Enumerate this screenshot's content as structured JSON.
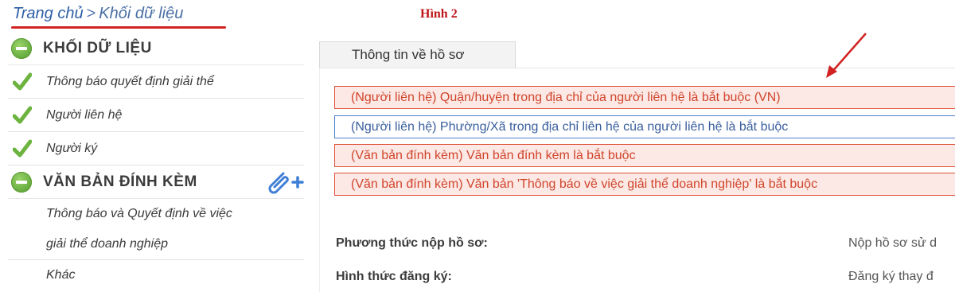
{
  "breadcrumb": {
    "home": "Trang chủ",
    "separator": ">",
    "current": "Khối dữ liệu"
  },
  "figure_caption": "Hình 2",
  "sidebar": {
    "section_data": "KHỐI DỮ LIỆU",
    "data_items": [
      {
        "label": "Thông báo quyết định giải thể",
        "status": "check"
      },
      {
        "label": "Người liên hệ",
        "status": "check"
      },
      {
        "label": "Người ký",
        "status": "check"
      }
    ],
    "section_attach": "VĂN BẢN ĐÍNH KÈM",
    "attach_items": [
      {
        "line1": "Thông báo và Quyết định về việc",
        "line2": "giải thể doanh nghiệp"
      },
      {
        "label": "Khác"
      }
    ]
  },
  "panel": {
    "tab_label": "Thông tin về hồ sơ"
  },
  "messages": [
    {
      "type": "error",
      "text": "(Người liên hệ) Quận/huyện trong địa chỉ của người liên hệ là bắt buộc (VN)"
    },
    {
      "type": "info",
      "text": "(Người liên hệ) Phường/Xã trong địa chỉ liên hệ của người liên hệ là bắt buộc"
    },
    {
      "type": "error",
      "text": "(Văn bản đính kèm) Văn bản đính kèm là bắt buộc"
    },
    {
      "type": "error",
      "text": "(Văn bản đính kèm) Văn bản 'Thông báo về việc giải thể doanh nghiệp' là bắt buộc"
    }
  ],
  "fields": {
    "submit_method_label": "Phương thức nộp hồ sơ:",
    "submit_method_value": "Nộp hồ sơ sử d",
    "register_form_label": "Hình thức đăng ký:",
    "register_form_value": "Đăng ký thay đ"
  },
  "colors": {
    "error_border": "#e0533a",
    "error_bg": "#fce8e4",
    "info_border": "#4a7fd0",
    "accent_green": "#4e9a2a",
    "annotation_red": "#d32222"
  },
  "icons": {
    "section_toggle": "minus-circle-icon",
    "item_status": "check-icon",
    "attach": "paperclip-plus-icon",
    "annotation": "arrow-icon"
  }
}
